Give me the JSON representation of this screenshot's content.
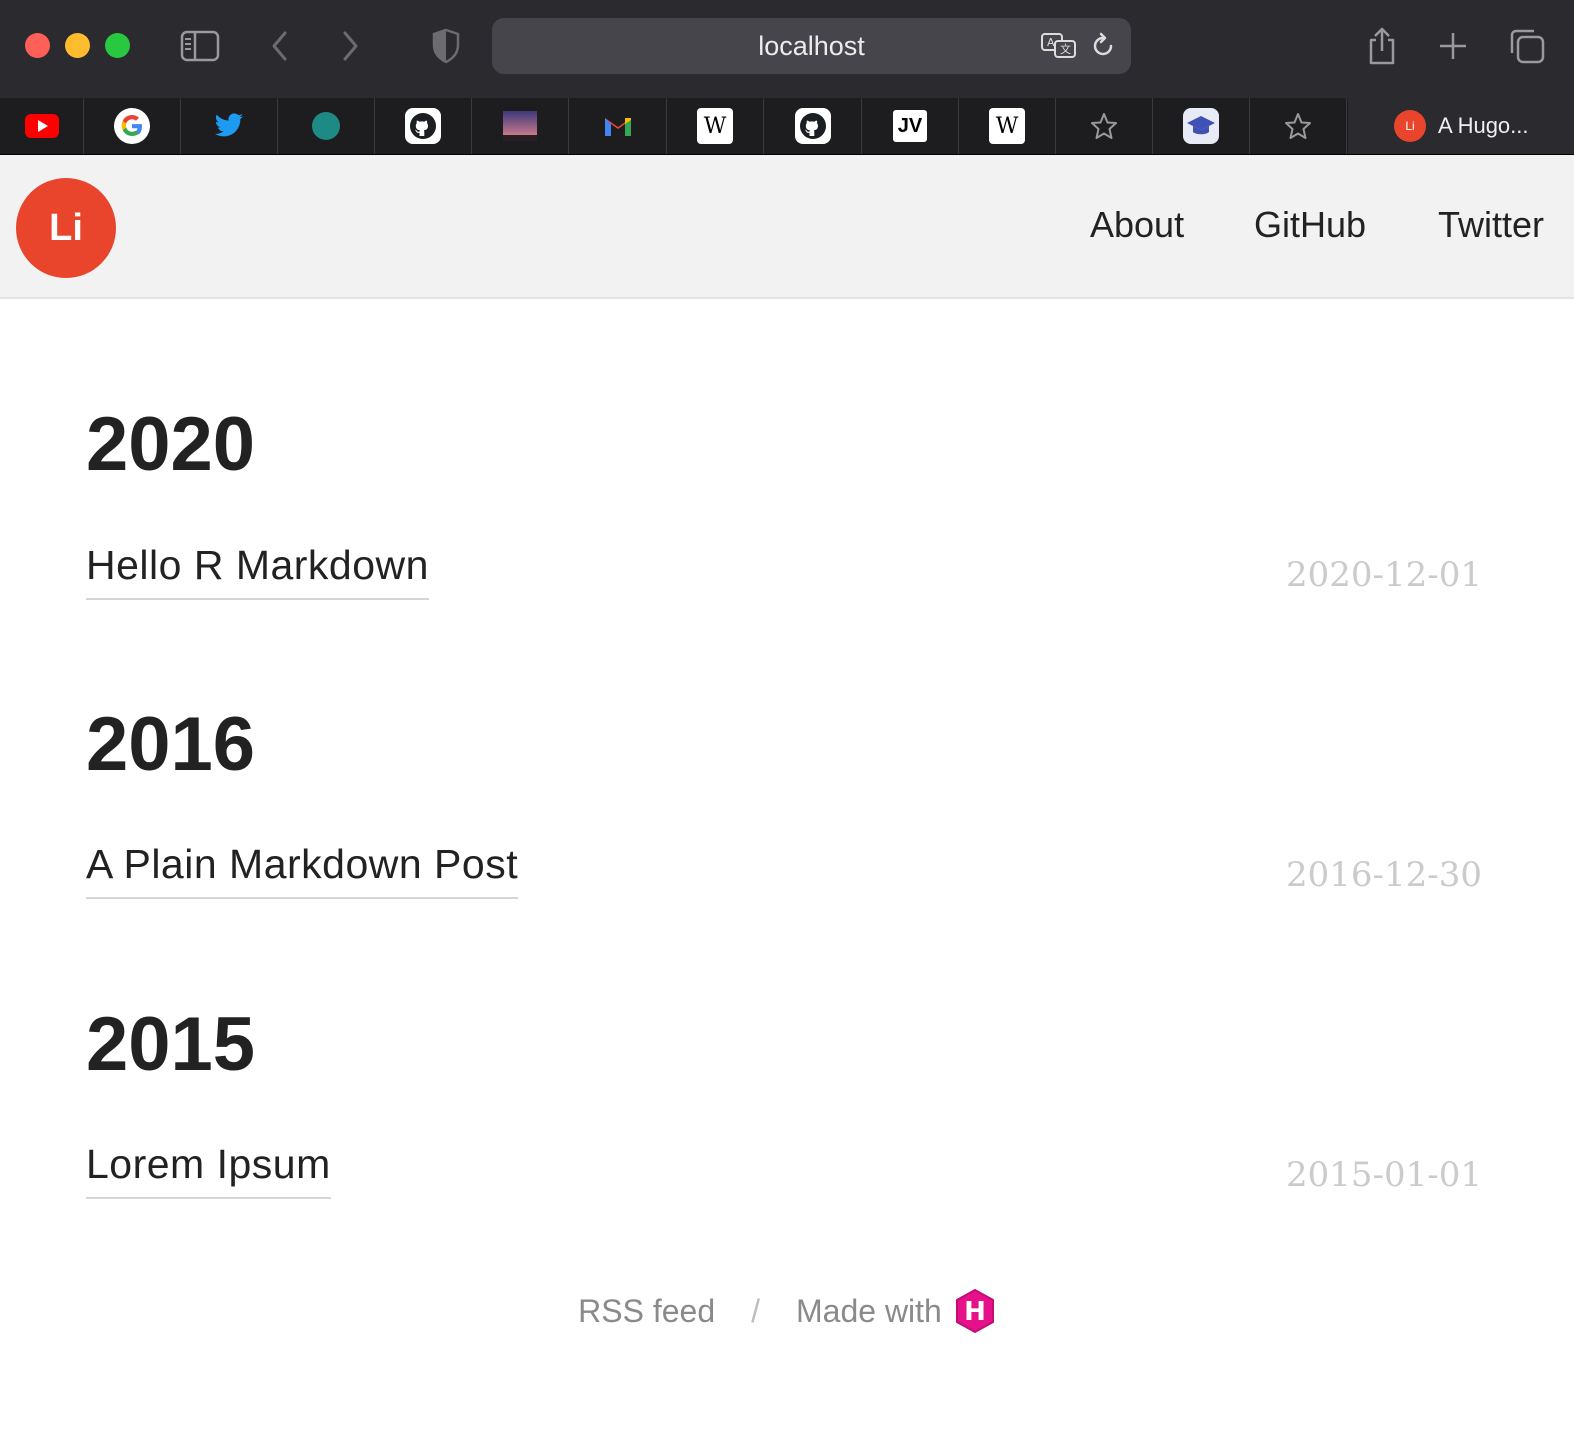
{
  "browser": {
    "url": "localhost",
    "active_tab_title": "A Hugo...",
    "active_tab_favicon_text": "Li",
    "favorites": [
      {
        "name": "youtube"
      },
      {
        "name": "google"
      },
      {
        "name": "twitter"
      },
      {
        "name": "teal-circle"
      },
      {
        "name": "github"
      },
      {
        "name": "photo"
      },
      {
        "name": "gmail"
      },
      {
        "name": "wikipedia"
      },
      {
        "name": "github"
      },
      {
        "name": "jv",
        "text": "JV"
      },
      {
        "name": "wikipedia"
      },
      {
        "name": "star"
      },
      {
        "name": "graduation-cap"
      },
      {
        "name": "star"
      }
    ]
  },
  "site": {
    "logo_text": "Li",
    "nav": {
      "about": "About",
      "github": "GitHub",
      "twitter": "Twitter"
    }
  },
  "archive": [
    {
      "year": "2020",
      "posts": [
        {
          "title": "Hello R Markdown",
          "date": "2020-12-01"
        }
      ]
    },
    {
      "year": "2016",
      "posts": [
        {
          "title": "A Plain Markdown Post",
          "date": "2016-12-30"
        }
      ]
    },
    {
      "year": "2015",
      "posts": [
        {
          "title": "Lorem Ipsum",
          "date": "2015-01-01"
        }
      ]
    }
  ],
  "footer": {
    "rss": "RSS feed",
    "separator": "/",
    "made_with": "Made with",
    "hugo_letter": "H"
  },
  "colors": {
    "accent": "#e8452c",
    "hugo": "#e6108a",
    "date": "#cbcbcb"
  }
}
